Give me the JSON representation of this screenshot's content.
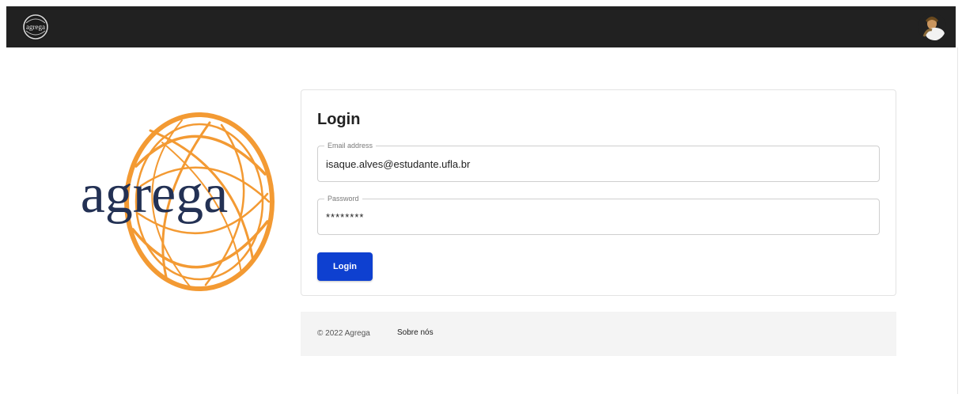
{
  "navbar": {
    "logo_text": "agrega",
    "avatar_icon": "user-avatar-icon"
  },
  "brand": {
    "logo_text": "agrega",
    "ring_color": "#f39a33",
    "text_color": "#233154"
  },
  "login": {
    "title": "Login",
    "email_label": "Email address",
    "email_value": "isaque.alves@estudante.ufla.br",
    "password_label": "Password",
    "password_value": "********",
    "button_label": "Login",
    "button_color": "#0e40d0"
  },
  "footer": {
    "copyright": "© 2022 Agrega",
    "about_link": "Sobre nós"
  }
}
